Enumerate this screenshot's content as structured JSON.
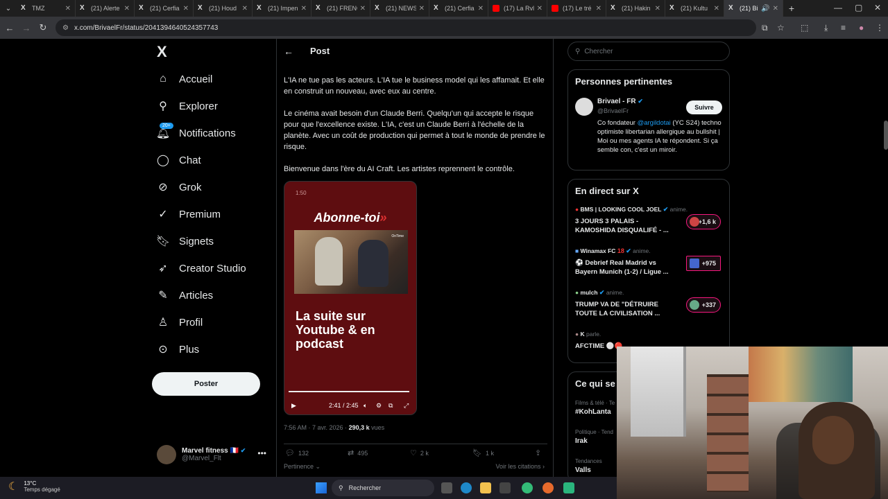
{
  "browser": {
    "tabs": [
      {
        "title": "TMZ",
        "icon": "x-logo-icon"
      },
      {
        "title": "(21) Alerte",
        "icon": "x-logo-icon"
      },
      {
        "title": "(21) Cerfia",
        "icon": "x-logo-icon"
      },
      {
        "title": "(21) Houd",
        "icon": "x-logo-icon"
      },
      {
        "title": "(21) Impen",
        "icon": "x-logo-icon"
      },
      {
        "title": "(21) FRENC",
        "icon": "x-logo-icon"
      },
      {
        "title": "(21) NEWS",
        "icon": "x-logo-icon"
      },
      {
        "title": "(21) Cerfia",
        "icon": "x-logo-icon"
      },
      {
        "title": "(17) La Rvl",
        "icon": "youtube-icon"
      },
      {
        "title": "(17) Le tré",
        "icon": "youtube-icon"
      },
      {
        "title": "(21) Hakin",
        "icon": "x-logo-icon"
      },
      {
        "title": "(21) Kultu",
        "icon": "x-logo-icon"
      },
      {
        "title": "(21) Bi",
        "icon": "x-logo-icon"
      }
    ],
    "url": "x.com/BrivaelFr/status/2041394640524357743"
  },
  "nav": {
    "logo": "X",
    "items": [
      {
        "label": "Accueil",
        "icon": "home-icon"
      },
      {
        "label": "Explorer",
        "icon": "search-icon"
      },
      {
        "label": "Notifications",
        "icon": "bell-icon",
        "badge": "20+"
      },
      {
        "label": "Chat",
        "icon": "chat-icon"
      },
      {
        "label": "Grok",
        "icon": "grok-icon"
      },
      {
        "label": "Premium",
        "icon": "premium-icon"
      },
      {
        "label": "Signets",
        "icon": "bookmark-icon"
      },
      {
        "label": "Creator Studio",
        "icon": "rocket-icon"
      },
      {
        "label": "Articles",
        "icon": "article-icon"
      },
      {
        "label": "Profil",
        "icon": "user-icon"
      },
      {
        "label": "Plus",
        "icon": "more-circle-icon"
      }
    ],
    "post_button": "Poster",
    "account": {
      "name": "Marvel fitness",
      "flag": "🇫🇷",
      "handle": "@Marvel_Flt"
    }
  },
  "post": {
    "header": "Post",
    "paragraphs": [
      "L'IA ne tue pas les acteurs. L'IA tue le business model qui les affamait. Et elle en construit un nouveau, avec eux au centre.",
      "Le cinéma avait besoin d'un Claude Berri. Quelqu'un qui accepte le risque pour que l'excellence existe. L'IA, c'est un Claude Berri à l'échelle de la planète. Avec un coût de production qui permet à tout le monde de prendre le risque.",
      "Bienvenue dans l'ère du AI Craft. Les artistes reprennent le contrôle."
    ],
    "video": {
      "top_time": "1:50",
      "headline": "Abonne-toi",
      "photo_tag": "OnTime",
      "subtitle": "La suite sur Youtube & en podcast",
      "time": "2:41 / 2:45",
      "progress": 0.98
    },
    "timestamp": "7:56 AM · 7 avr. 2026 · ",
    "views_count": "290,3 k",
    "views_label": " vues",
    "engagement": {
      "replies": "132",
      "reposts": "495",
      "likes": "2 k",
      "bookmarks": "1 k"
    },
    "pertinence": "Pertinence",
    "see_quotes": "Voir les citations"
  },
  "right": {
    "search_placeholder": "Chercher",
    "relevant": {
      "title": "Personnes pertinentes",
      "name": "Brivael - FR",
      "handle": "@BrivaelFr",
      "follow": "Suivre",
      "bio_mention": "@argildotai",
      "bio_rest": " (YC S24) techno optimiste libertarian allergique au bullshit | Moi ou mes agents IA te répondent. Si ça semble con, c'est un miroir.",
      "bio_prefix": "Co fondateur "
    },
    "live": {
      "title": "En direct sur X",
      "items": [
        {
          "host": "BMS | LOOKING COOL JOEL",
          "verb": " anime.",
          "title": "3 JOURS 3 PALAIS - KAMOSHIDA DISQUALIFÉ - ...",
          "count": "+1,6 k"
        },
        {
          "host": "Winamax FC",
          "verb": " anime.",
          "title": "⚽ Debrief Real Madrid vs Bayern Munich (1-2) / Ligue ...",
          "count": "+975"
        },
        {
          "host": "mulch",
          "verb": " anime.",
          "title": "TRUMP VA DE \"DÉTRUIRE TOUTE LA CIVILISATION ...",
          "count": "+337"
        },
        {
          "host": "K",
          "verb": " parle.",
          "title": "AFCTIME ⚪🔴",
          "count": ""
        }
      ]
    },
    "trends": {
      "title": "Ce qui se",
      "items": [
        {
          "category": "Films & télé · Te",
          "name": "#KohLanta"
        },
        {
          "category": "Politique · Tend",
          "name": "Irak"
        },
        {
          "category": "Tendances",
          "name": "Valls"
        }
      ]
    }
  },
  "taskbar": {
    "temp": "13°C",
    "weather": "Temps dégagé",
    "search": "Rechercher"
  }
}
